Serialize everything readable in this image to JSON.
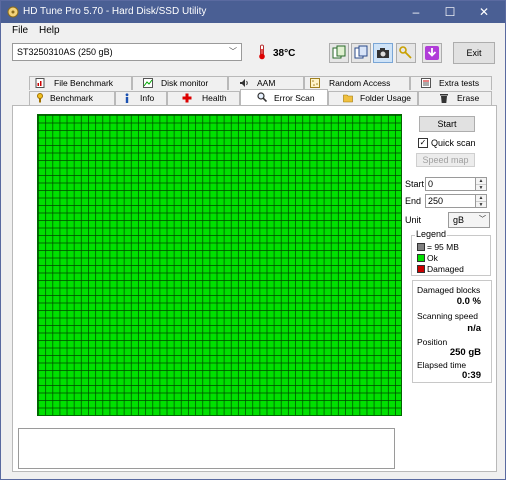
{
  "window": {
    "title": "HD Tune Pro 5.70 - Hard Disk/SSD Utility"
  },
  "menu": [
    {
      "label": "File"
    },
    {
      "label": "Help"
    }
  ],
  "toolbar": {
    "drive": "ST3250310AS (250 gB)",
    "temperature": "38°C",
    "exit_label": "Exit",
    "icons": [
      "copy-info-icon",
      "copy-screenshot-icon",
      "screenshot-camera-icon",
      "options-keys-icon",
      "save-download-icon"
    ]
  },
  "tabs": {
    "row1": [
      {
        "label": "File Benchmark",
        "icon": "file-benchmark-icon"
      },
      {
        "label": "Disk monitor",
        "icon": "disk-monitor-icon"
      },
      {
        "label": "AAM",
        "icon": "speaker-icon"
      },
      {
        "label": "Random Access",
        "icon": "random-access-icon"
      },
      {
        "label": "Extra tests",
        "icon": "extra-tests-icon"
      }
    ],
    "row2": [
      {
        "label": "Benchmark",
        "icon": "benchmark-icon"
      },
      {
        "label": "Info",
        "icon": "info-icon"
      },
      {
        "label": "Health",
        "icon": "health-cross-icon"
      },
      {
        "label": "Error Scan",
        "icon": "magnifier-icon"
      },
      {
        "label": "Folder Usage",
        "icon": "folder-icon"
      },
      {
        "label": "Erase",
        "icon": "trash-icon"
      }
    ],
    "selected": "Error Scan"
  },
  "scan": {
    "start_label": "Start",
    "quick_scan_label": "Quick scan",
    "quick_scan_checked": true,
    "speed_map_label": "Speed map",
    "start_field_label": "Start",
    "start_value": "0",
    "end_field_label": "End",
    "end_value": "250",
    "unit_label": "Unit",
    "unit_value": "gB"
  },
  "legend": {
    "title": "Legend",
    "items": [
      {
        "label": "= 95 MB",
        "color": "#808080"
      },
      {
        "label": "Ok",
        "color": "#00e000"
      },
      {
        "label": "Damaged",
        "color": "#cc0000"
      }
    ]
  },
  "stats": {
    "damaged_label": "Damaged blocks",
    "damaged_value": "0.0 %",
    "speed_label": "Scanning speed",
    "speed_value": "n/a",
    "position_label": "Position",
    "position_value": "250 gB",
    "elapsed_label": "Elapsed time",
    "elapsed_value": "0:39"
  },
  "colors": {
    "ok": "#00e000",
    "damaged": "#cc0000",
    "titlebar": "#4a5f94"
  }
}
